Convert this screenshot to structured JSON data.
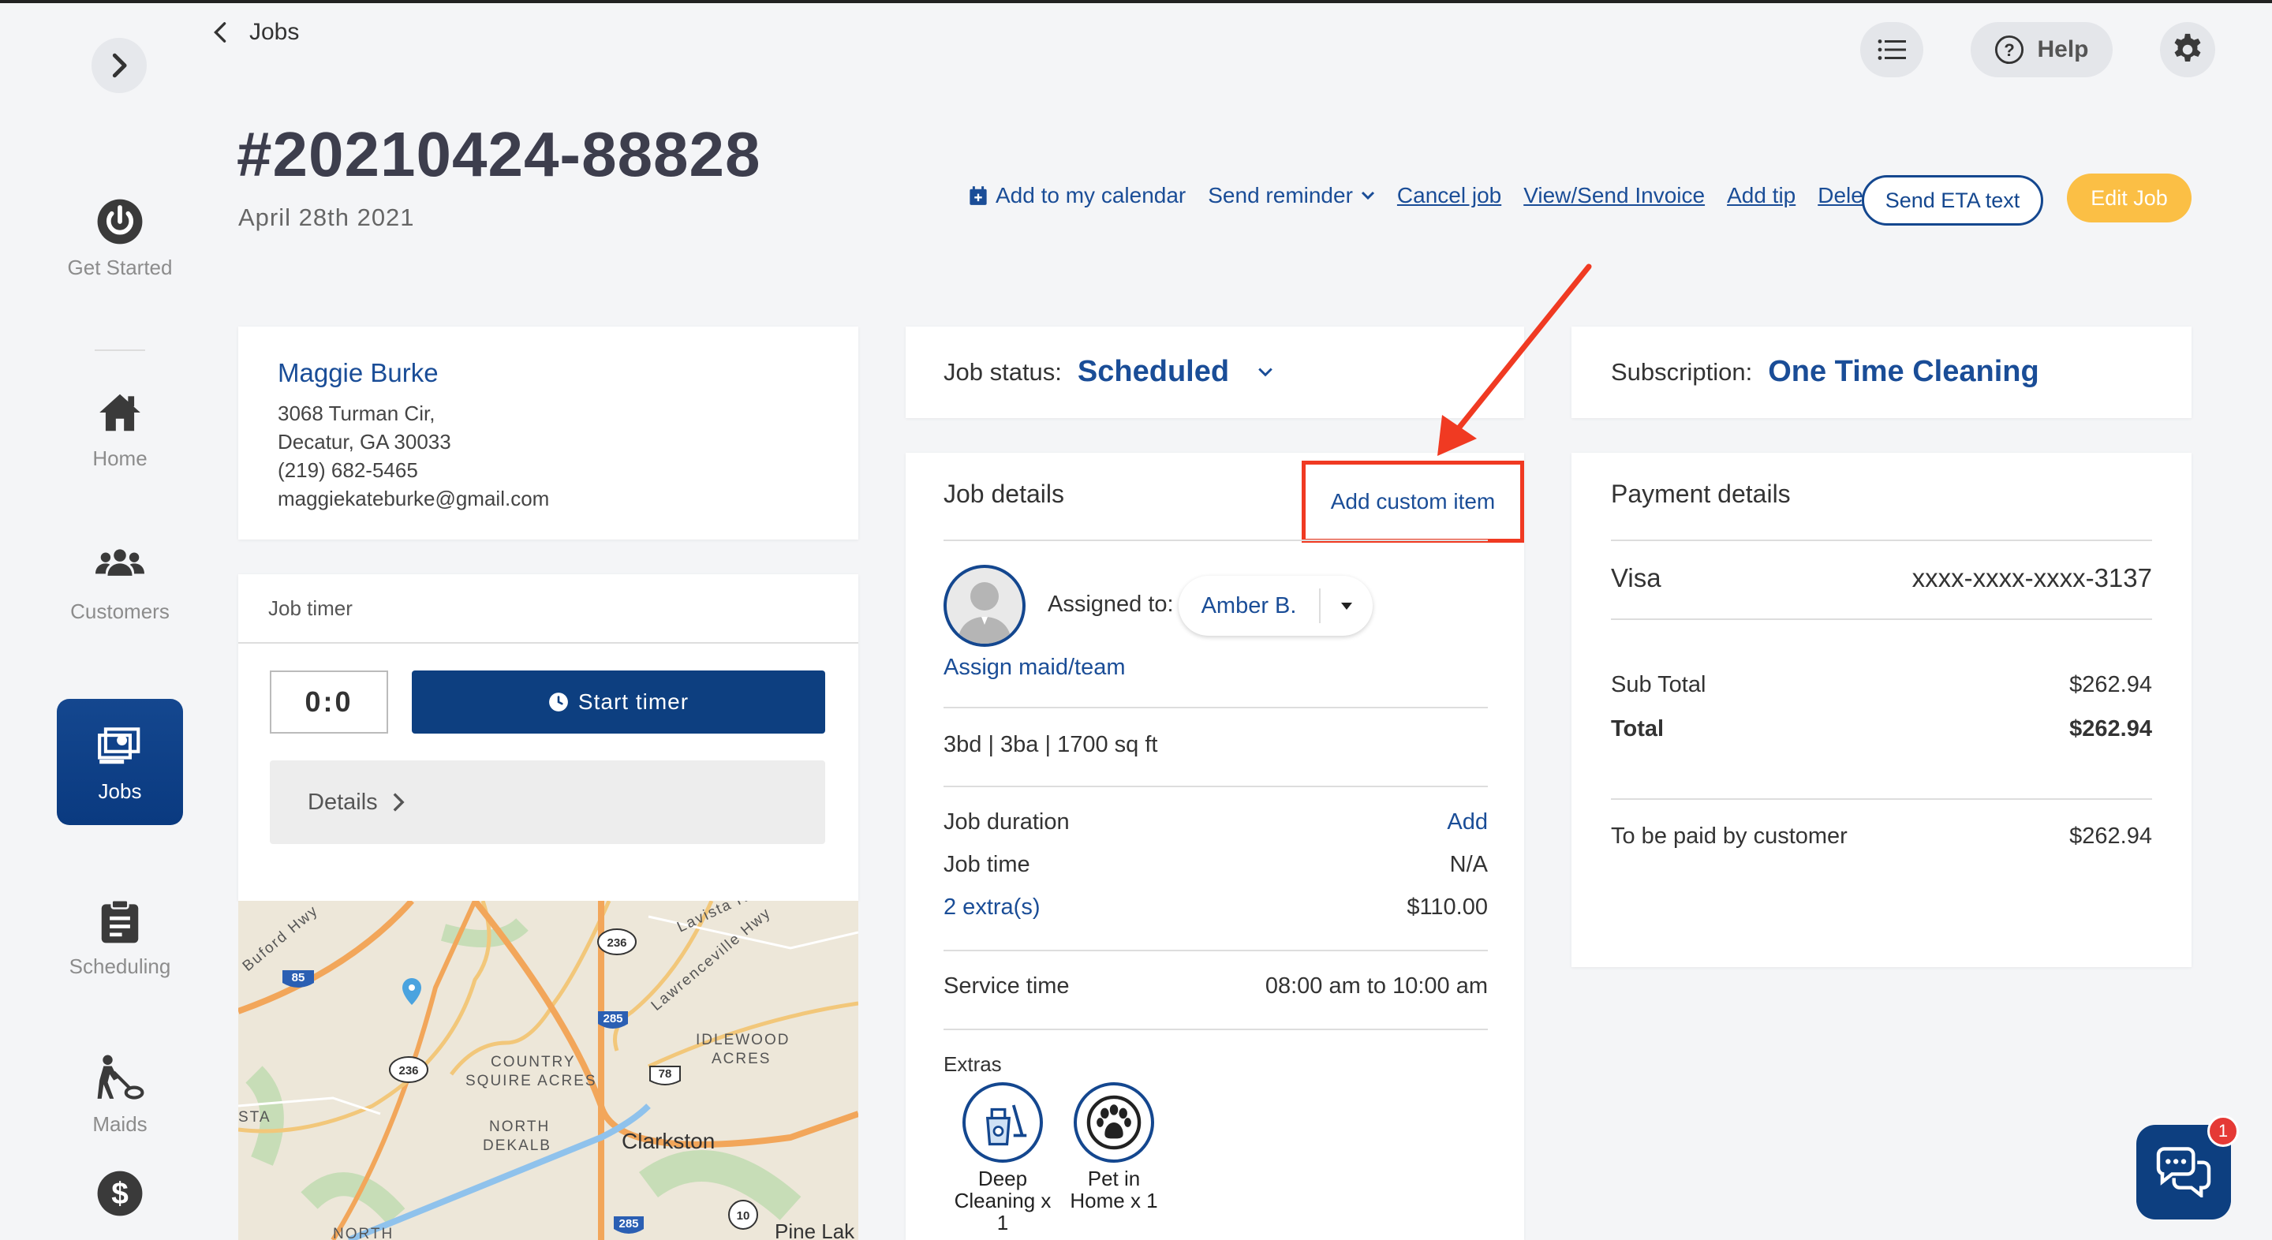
{
  "sidebar": {
    "items": [
      {
        "label": "Get Started",
        "icon": "power-icon"
      },
      {
        "label": "Home",
        "icon": "home-icon"
      },
      {
        "label": "Customers",
        "icon": "users-icon"
      },
      {
        "label": "Jobs",
        "icon": "jobs-icon"
      },
      {
        "label": "Scheduling",
        "icon": "clipboard-icon"
      },
      {
        "label": "Maids",
        "icon": "cleaner-icon"
      },
      {
        "label": "",
        "icon": "dollar-icon"
      }
    ]
  },
  "header": {
    "back_label": "Jobs",
    "help_label": "Help",
    "job_number": "#20210424-88828",
    "job_date": "April 28th 2021"
  },
  "actions": {
    "add_calendar": "Add to my calendar",
    "send_reminder": "Send reminder",
    "cancel_job": "Cancel job",
    "view_invoice": "View/Send Invoice",
    "add_tip": "Add tip",
    "delete_job": "Delete job",
    "send_eta": "Send ETA text",
    "edit_job": "Edit Job"
  },
  "customer": {
    "name": "Maggie Burke",
    "address1": "3068 Turman Cir,",
    "address2": "Decatur, GA 30033",
    "phone": "(219) 682-5465",
    "email": "maggiekateburke@gmail.com"
  },
  "timer": {
    "title": "Job timer",
    "value": "0:0",
    "start_label": "Start timer",
    "details_label": "Details"
  },
  "map": {
    "labels": [
      "Buford Hwy",
      "Lavista Rd",
      "Lawrenceville Hwy",
      "IDLEWOOD",
      "ACRES",
      "COUNTRY",
      "SQUIRE ACRES",
      "NORTH",
      "DEKALB",
      "Clarkston",
      "STA",
      "Pine Lak",
      "NORTH"
    ],
    "shields": [
      "85",
      "236",
      "285",
      "236",
      "78",
      "285",
      "10"
    ]
  },
  "job_status": {
    "label": "Job status:",
    "value": "Scheduled"
  },
  "job_details": {
    "title": "Job details",
    "add_custom": "Add custom item",
    "assigned_label": "Assigned to:",
    "assigned_value": "Amber B.",
    "assign_link": "Assign maid/team",
    "home_size": "3bd | 3ba | 1700 sq ft",
    "duration_label": "Job duration",
    "duration_value": "Add",
    "time_label": "Job time",
    "time_value": "N/A",
    "extras_link": "2 extra(s)",
    "extras_value": "$110.00",
    "service_label": "Service time",
    "service_value": "08:00 am to 10:00 am",
    "extras_title": "Extras",
    "extras": [
      {
        "label": "Deep Cleaning x 1",
        "icon": "deep-cleaning-icon"
      },
      {
        "label": "Pet in Home x 1",
        "icon": "paw-icon"
      }
    ]
  },
  "subscription": {
    "label": "Subscription:",
    "value": "One Time Cleaning"
  },
  "payment": {
    "title": "Payment details",
    "card_type": "Visa",
    "card_number": "xxxx-xxxx-xxxx-3137",
    "subtotal_label": "Sub Total",
    "subtotal_value": "$262.94",
    "total_label": "Total",
    "total_value": "$262.94",
    "due_label": "To be paid by customer",
    "due_value": "$262.94"
  },
  "chat": {
    "badge": "1"
  },
  "colors": {
    "primary": "#14478f",
    "link": "#1a4d97",
    "accent": "#fbbf45",
    "annotation": "#f03a22"
  }
}
